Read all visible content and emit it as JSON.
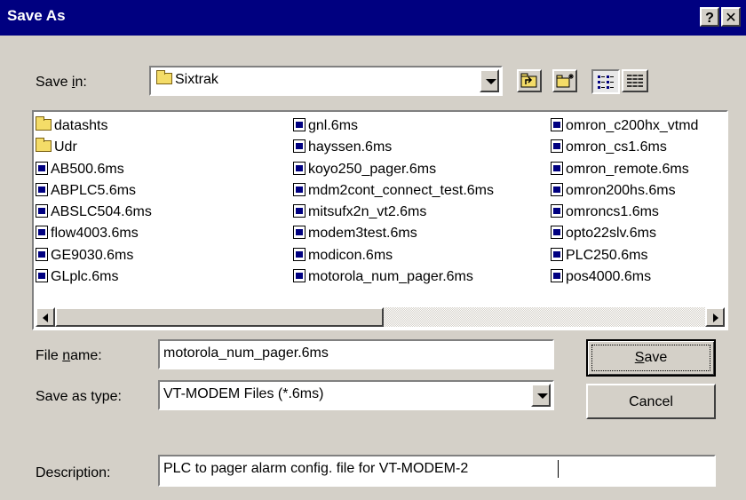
{
  "title": "Save As",
  "title_buttons": {
    "help": "?",
    "close": "✕"
  },
  "save_in": {
    "label_pre": "Save ",
    "label_key": "i",
    "label_post": "n:",
    "value": "Sixtrak"
  },
  "files": {
    "col1": [
      "datashts",
      "Udr",
      "AB500.6ms",
      "ABPLC5.6ms",
      "ABSLC504.6ms",
      "flow4003.6ms",
      "GE9030.6ms",
      "GLplc.6ms"
    ],
    "col2": [
      "gnl.6ms",
      "hayssen.6ms",
      "koyo250_pager.6ms",
      "mdm2cont_connect_test.6ms",
      "mitsufx2n_vt2.6ms",
      "modem3test.6ms",
      "modicon.6ms",
      "motorola_num_pager.6ms"
    ],
    "col3": [
      "omron_c200hx_vtmd",
      "omron_cs1.6ms",
      "omron_remote.6ms",
      "omron200hs.6ms",
      "omroncs1.6ms",
      "opto22slv.6ms",
      "PLC250.6ms",
      "pos4000.6ms"
    ]
  },
  "file_name": {
    "label_pre": "File ",
    "label_key": "n",
    "label_post": "ame:",
    "value": "motorola_num_pager.6ms"
  },
  "save_as_type": {
    "label": "Save as type:",
    "value": "VT-MODEM Files (*.6ms)"
  },
  "buttons": {
    "save_key": "S",
    "save_rest": "ave",
    "cancel": "Cancel"
  },
  "description": {
    "label": "Description:",
    "value": "PLC to pager alarm config. file for VT-MODEM-2"
  }
}
